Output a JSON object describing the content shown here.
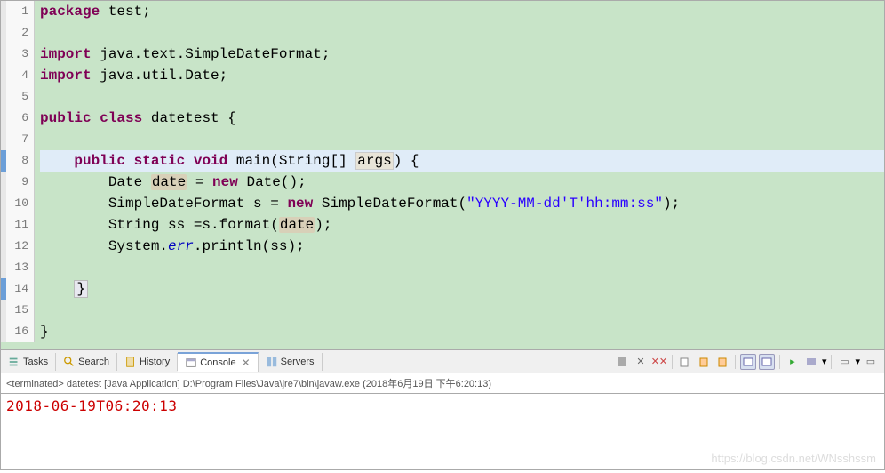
{
  "gutter": [
    "1",
    "2",
    "3",
    "4",
    "5",
    "6",
    "7",
    "8",
    "9",
    "10",
    "11",
    "12",
    "13",
    "14",
    "15",
    "16"
  ],
  "code": {
    "l1": {
      "kw1": "package",
      "rest": " test;"
    },
    "l3": {
      "kw1": "import",
      "rest": " java.text.SimpleDateFormat;"
    },
    "l4": {
      "kw1": "import",
      "rest": " java.util.Date;"
    },
    "l6": {
      "kw1": "public",
      "kw2": "class",
      "name": " datetest {"
    },
    "l8": {
      "indent": "    ",
      "kw1": "public",
      "kw2": "static",
      "kw3": "void",
      "method": " main(String[] ",
      "param": "args",
      "rest": ") {"
    },
    "l9": {
      "indent": "        Date ",
      "var": "date",
      "eq": " = ",
      "kw": "new",
      "rest": " Date();"
    },
    "l10": {
      "indent": "        SimpleDateFormat s = ",
      "kw": "new",
      "mid": " SimpleDateFormat(",
      "str": "\"YYYY-MM-dd'T'hh:mm:ss\"",
      "rest": ");"
    },
    "l11": {
      "indent": "        String ss =s.format(",
      "var": "date",
      "rest": ");"
    },
    "l12": {
      "indent": "        System.",
      "field": "err",
      "rest": ".println(ss);"
    },
    "l14": {
      "indent": "    ",
      "brace": "}"
    },
    "l16": "}"
  },
  "tabs": {
    "items": [
      {
        "label": "Tasks",
        "icon": "tasks-icon"
      },
      {
        "label": "Search",
        "icon": "search-icon"
      },
      {
        "label": "History",
        "icon": "history-icon"
      },
      {
        "label": "Console",
        "icon": "console-icon",
        "active": true,
        "closable": true
      },
      {
        "label": "Servers",
        "icon": "servers-icon"
      }
    ]
  },
  "console": {
    "header": "<terminated> datetest [Java Application] D:\\Program Files\\Java\\jre7\\bin\\javaw.exe (2018年6月19日 下午6:20:13)",
    "output": "2018-06-19T06:20:13"
  },
  "watermark": "https://blog.csdn.net/WNsshssm"
}
